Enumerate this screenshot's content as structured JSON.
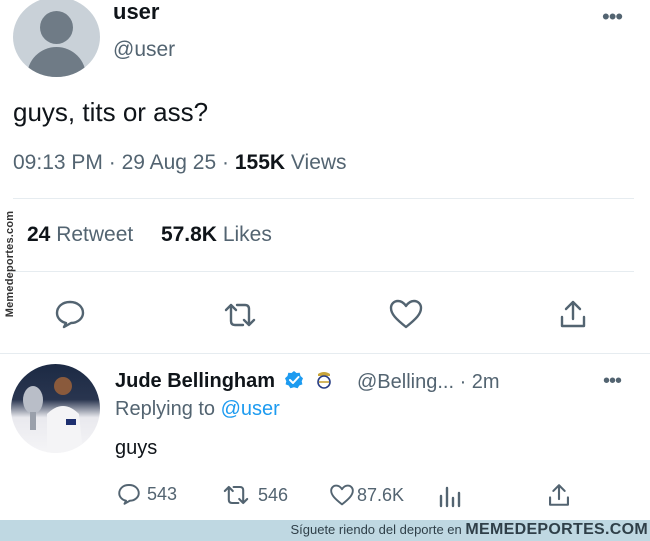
{
  "main_tweet": {
    "display_name": "user",
    "handle": "@user",
    "text": "guys, tits or ass?",
    "time": "09:13 PM",
    "sep1": "·",
    "date": "29 Aug 25",
    "sep2": "·",
    "views_count": "155K",
    "views_label": "Views",
    "retweets_count": "24",
    "retweets_label": "Retweet",
    "likes_count": "57.8K",
    "likes_label": "Likes",
    "more": "•••"
  },
  "reply": {
    "display_name": "Jude Bellingham",
    "handle_time": "@Belling... · 2m",
    "replying_prefix": "Replying to",
    "replying_handle": "@user",
    "text": "guys",
    "reply_count": "543",
    "retweet_count": "546",
    "like_count": "87.6K",
    "more": "•••"
  },
  "watermark": {
    "side": "Memedeportes.com",
    "bottom_small": "Síguete riendo del deporte en",
    "bottom_big": "MEMEDEPORTES.COM"
  },
  "colors": {
    "accent": "#1d9bf0",
    "muted": "#536471",
    "verified": "#1d9bf0",
    "footer_bar": "#bfd8e2"
  },
  "icons": [
    "reply-icon",
    "retweet-icon",
    "like-icon",
    "share-icon",
    "views-icon",
    "verified-badge-icon",
    "club-crest-icon",
    "more-icon"
  ]
}
